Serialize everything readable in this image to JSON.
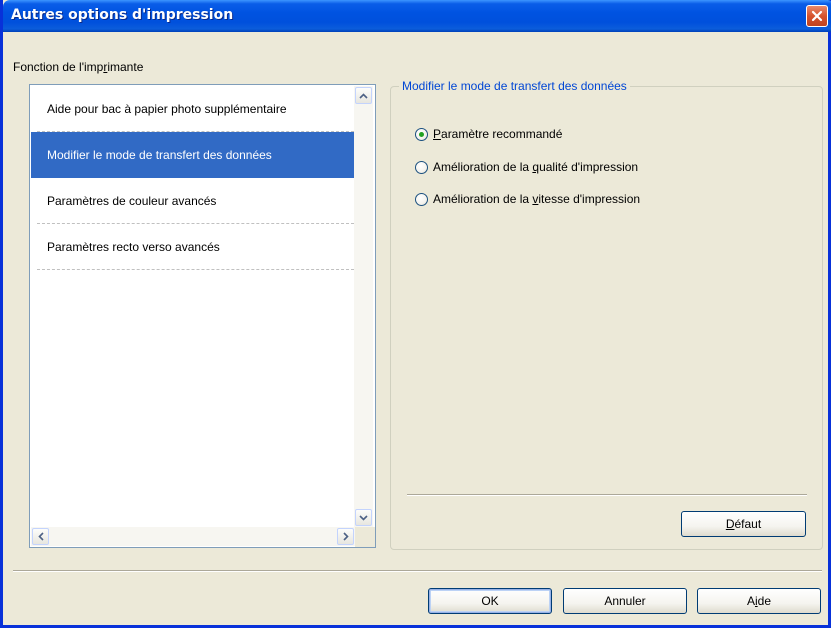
{
  "window": {
    "title": "Autres options d'impression"
  },
  "function_label": {
    "pre": "Fonction de l'imp",
    "accel": "r",
    "post": "imante"
  },
  "list": {
    "items": [
      "Aide pour bac à papier photo supplémentaire",
      "Modifier le mode de transfert des données",
      "Paramètres de couleur avancés",
      "Paramètres recto verso avancés"
    ],
    "selected_index": 1
  },
  "group": {
    "title": "Modifier le mode de transfert des données",
    "options": [
      {
        "pre": "",
        "accel": "P",
        "post": "aramètre recommandé",
        "checked": true
      },
      {
        "pre": "Amélioration de la ",
        "accel": "q",
        "post": "ualité d'impression",
        "checked": false
      },
      {
        "pre": "Amélioration de la ",
        "accel": "v",
        "post": "itesse d'impression",
        "checked": false
      }
    ],
    "default_button": {
      "pre": "",
      "accel": "D",
      "post": "éfaut"
    }
  },
  "buttons": {
    "ok": "OK",
    "cancel": "Annuler",
    "help": {
      "pre": "A",
      "accel": "i",
      "post": "de"
    }
  },
  "icons": {
    "close": "close-icon",
    "scroll_up": "chevron-up-icon",
    "scroll_down": "chevron-down-icon",
    "scroll_left": "chevron-left-icon",
    "scroll_right": "chevron-right-icon"
  },
  "colors": {
    "titlebar": "#0053e1",
    "selection": "#316ac5",
    "group_title": "#0046d5",
    "dialog_bg": "#ece9d8",
    "close_button": "#d6532d",
    "radio_dot": "#21a121"
  }
}
